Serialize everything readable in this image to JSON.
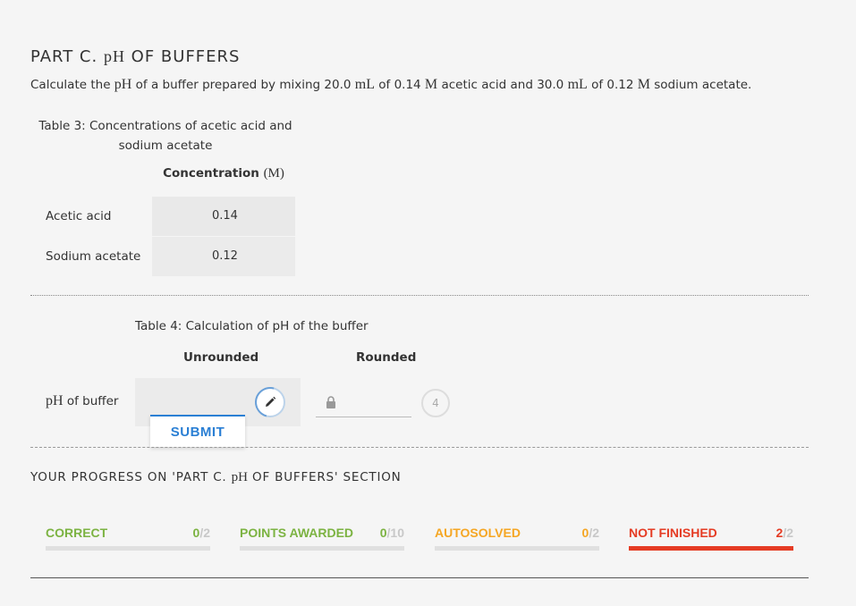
{
  "section": {
    "title_pre": "PART C. ",
    "title_math": "pH",
    "title_post": " OF BUFFERS"
  },
  "question": {
    "p1": "Calculate the ",
    "m1": "pH",
    "p2": " of a buffer prepared by mixing 20.0 ",
    "m2": "mL",
    "p3": " of 0.14 ",
    "m3": "M",
    "p4": " acetic acid and 30.0 ",
    "m4": "mL",
    "p5": " of 0.12 ",
    "m5": "M",
    "p6": " sodium acetate."
  },
  "table3": {
    "caption_line1": "Table 3: Concentrations of acetic acid and",
    "caption_line2": "sodium acetate",
    "header_text": "Concentration ",
    "header_unit": "(M)",
    "rows": [
      {
        "label": "Acetic acid",
        "value": "0.14"
      },
      {
        "label": "Sodium acetate",
        "value": "0.12"
      }
    ]
  },
  "table4": {
    "caption": "Table 4: Calculation of pH of the buffer",
    "header_unrounded": "Unrounded",
    "header_rounded": "Rounded",
    "row_label_math": "pH",
    "row_label_text": " of buffer",
    "unrounded_value": "",
    "rounded_value": "",
    "sigfigs": "4",
    "submit_label": "SUBMIT"
  },
  "progress": {
    "heading_pre": "YOUR PROGRESS ON 'PART C. ",
    "heading_math": "pH",
    "heading_post": " OF BUFFERS' SECTION",
    "stats": [
      {
        "label": "CORRECT",
        "value": "0",
        "sep": "/",
        "total": "2",
        "fraction": 0,
        "color": "#7cb342"
      },
      {
        "label": "POINTS AWARDED",
        "value": "0",
        "sep": "/",
        "total": "10",
        "fraction": 0,
        "color": "#7cb342"
      },
      {
        "label": "AUTOSOLVED",
        "value": "0",
        "sep": "/",
        "total": "2",
        "fraction": 0,
        "color": "#f5a623"
      },
      {
        "label": "NOT FINISHED",
        "value": "2",
        "sep": "/",
        "total": "2",
        "fraction": 1,
        "color": "#e53c24"
      }
    ]
  },
  "icons": {
    "edit": "pencil-icon",
    "lock": "lock-icon"
  },
  "colors": {
    "accent": "#2a7fd4",
    "correct": "#7cb342",
    "autosolved": "#f5a623",
    "not_finished": "#e53c24"
  }
}
